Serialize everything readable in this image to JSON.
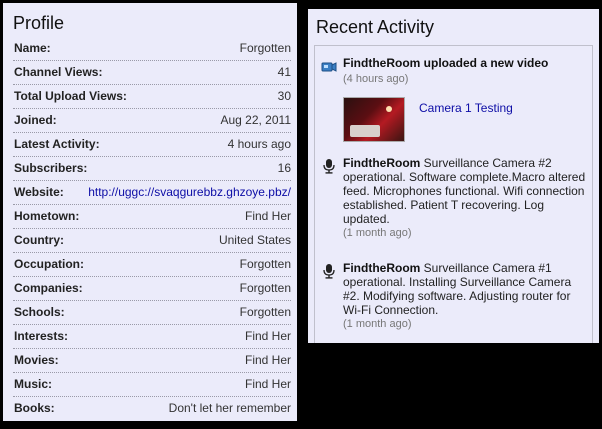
{
  "profile": {
    "title": "Profile",
    "rows": [
      {
        "label": "Name:",
        "value": "Forgotten"
      },
      {
        "label": "Channel Views:",
        "value": "41"
      },
      {
        "label": "Total Upload Views:",
        "value": "30"
      },
      {
        "label": "Joined:",
        "value": "Aug 22, 2011"
      },
      {
        "label": "Latest Activity:",
        "value": "4 hours ago"
      },
      {
        "label": "Subscribers:",
        "value": "16"
      },
      {
        "label": "Website:",
        "value": "http://uggc://svaqgurebbz.ghzoye.pbz/"
      },
      {
        "label": "Hometown:",
        "value": "Find Her"
      },
      {
        "label": "Country:",
        "value": "United States"
      },
      {
        "label": "Occupation:",
        "value": "Forgotten"
      },
      {
        "label": "Companies:",
        "value": "Forgotten"
      },
      {
        "label": "Schools:",
        "value": "Forgotten"
      },
      {
        "label": "Interests:",
        "value": "Find Her"
      },
      {
        "label": "Movies:",
        "value": "Find Her"
      },
      {
        "label": "Music:",
        "value": "Find Her"
      },
      {
        "label": "Books:",
        "value": "Don't let her remember"
      }
    ]
  },
  "activity": {
    "title": "Recent Activity",
    "items": [
      {
        "icon": "upload-icon",
        "user": "FindtheRoom",
        "text": "uploaded a new video",
        "time": "(4 hours ago)",
        "video_title": "Camera 1 Testing"
      },
      {
        "icon": "microphone-icon",
        "user": "FindtheRoom",
        "text": "Surveillance Camera #2 operational. Software complete.Macro altered feed. Microphones functional. Wifi connection established. Patient T recovering. Log updated.",
        "time": "(1 month ago)"
      },
      {
        "icon": "microphone-icon",
        "user": "FindtheRoom",
        "text": "Surveillance Camera #1 operational. Installing Surveillance Camera #2. Modifying software. Adjusting router for Wi-Fi Connection.",
        "time": "(1 month ago)"
      }
    ]
  }
}
